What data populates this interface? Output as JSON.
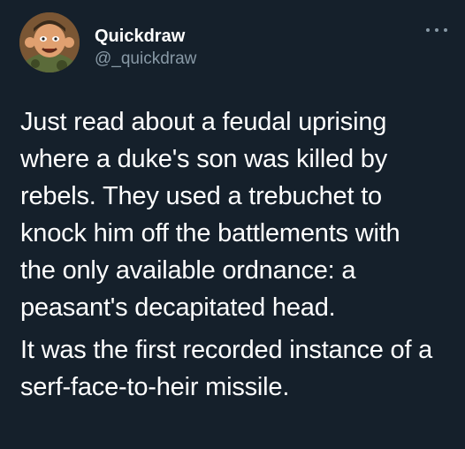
{
  "user": {
    "display_name": "Quickdraw",
    "handle": "@_quickdraw",
    "avatar_icon": "cartoon-soldier-avatar"
  },
  "tweet": {
    "paragraphs": [
      "Just read about a feudal uprising\nwhere a duke's son was killed by\nrebels. They used a trebuchet to\nknock him off the battlements with\nthe only available ordnance: a\npeasant's decapitated head.",
      "It was the first recorded instance of a\nserf-face-to-heir missile."
    ]
  },
  "colors": {
    "background": "#15202b",
    "text": "#ffffff",
    "secondary": "#8899a6"
  },
  "more_icon": "more-horizontal-icon"
}
